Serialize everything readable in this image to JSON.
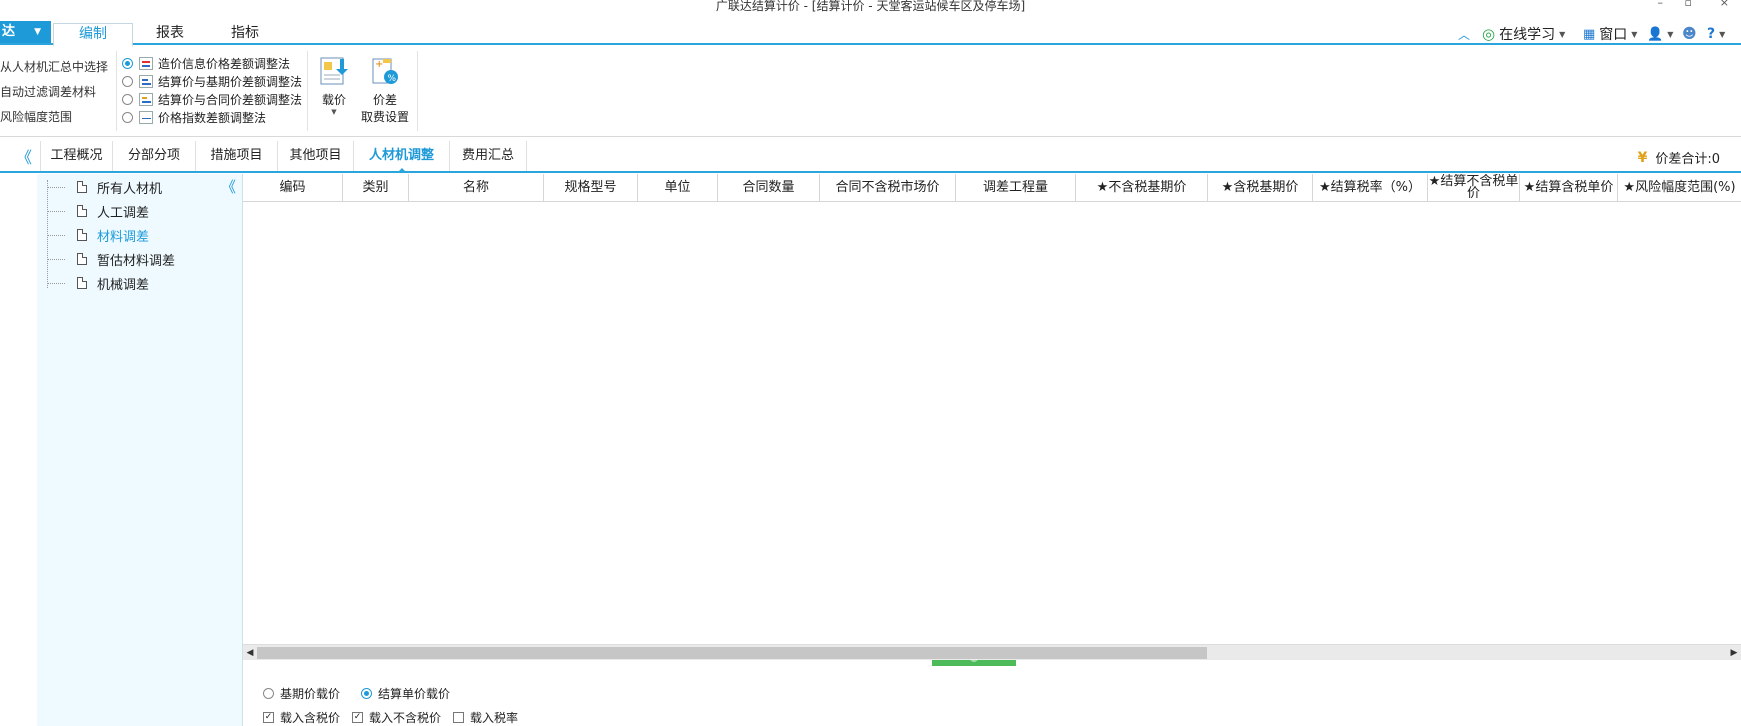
{
  "window": {
    "title": "广联达结算计价 - [结算计价 - 天堂客运站候车区及停车场]",
    "controls": [
      "–",
      "▫",
      "×"
    ]
  },
  "menu": {
    "app_button": "达",
    "tabs": [
      "编制",
      "报表",
      "指标"
    ],
    "active_tab": "编制",
    "right": {
      "online_learning": "在线学习",
      "window": "窗口",
      "help": "?"
    }
  },
  "ribbon": {
    "left_options": [
      "从人材机汇总中选择",
      "自动过滤调差材料",
      "风险幅度范围"
    ],
    "methods": [
      {
        "label": "造价信息价格差额调整法",
        "selected": true
      },
      {
        "label": "结算价与基期价差额调整法",
        "selected": false
      },
      {
        "label": "结算价与合同价差额调整法",
        "selected": false
      },
      {
        "label": "价格指数差额调整法",
        "selected": false
      }
    ],
    "load_price": "载价",
    "fee_setting_line1": "价差",
    "fee_setting_line2": "取费设置"
  },
  "tabs": {
    "items": [
      "工程概况",
      "分部分项",
      "措施项目",
      "其他项目",
      "人材机调整",
      "费用汇总"
    ],
    "active": "人材机调整",
    "price_total_label": "价差合计:0"
  },
  "tree": {
    "items": [
      "所有人材机",
      "人工调差",
      "材料调差",
      "暂估材料调差",
      "机械调差"
    ],
    "selected": "材料调差"
  },
  "grid": {
    "columns": [
      "编码",
      "类别",
      "名称",
      "规格型号",
      "单位",
      "合同数量",
      "合同不含税市场价",
      "调差工程量",
      "★不含税基期价",
      "★含税基期价",
      "★结算税率（%）",
      "★结算不含税单价",
      "★结算含税单价",
      "★风险幅度范围(%)"
    ]
  },
  "bottom": {
    "radio_base": "基期价载价",
    "radio_settle": "结算单价载价",
    "selected_radio": "结算单价载价",
    "check_tax_incl": "载入含税价",
    "check_tax_excl": "载入不含税价",
    "check_rate": "载入税率",
    "checked": [
      "载入含税价",
      "载入不含税价"
    ]
  },
  "colors": {
    "accent": "#1f9ad8",
    "tree_bg": "#eefaff",
    "splitter": "#4dbb5a"
  }
}
